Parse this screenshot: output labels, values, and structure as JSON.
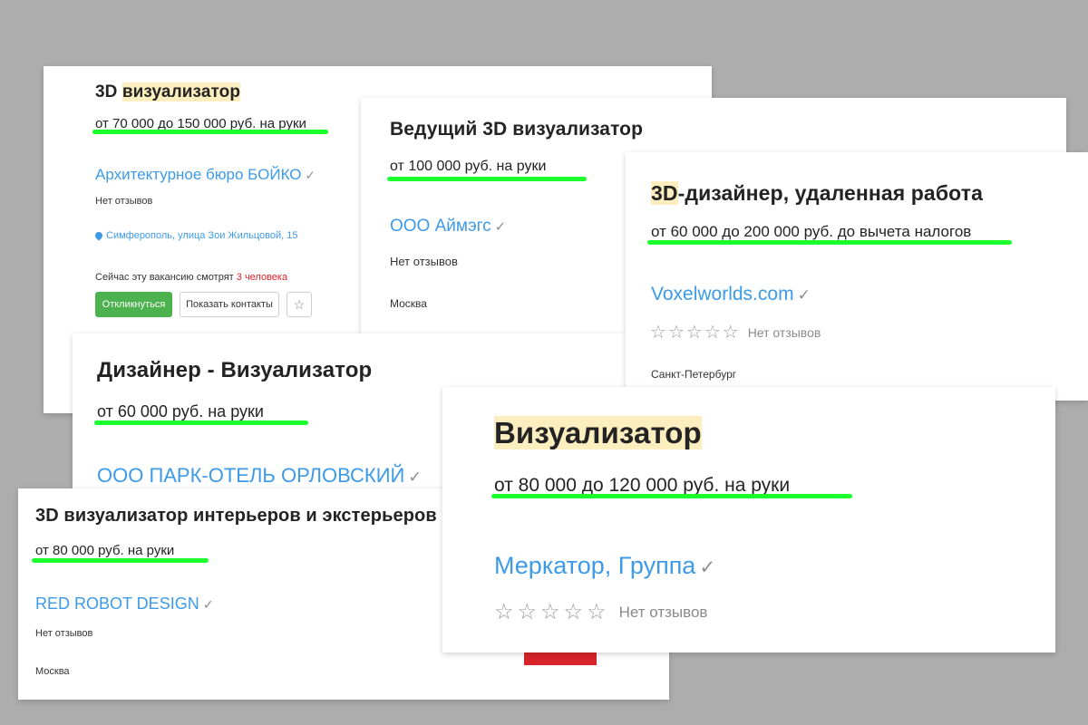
{
  "card1": {
    "title_highlight_prefix": "3D ",
    "title_highlight": "визуализатор",
    "salary": "от 70 000 до 150 000 руб. на руки",
    "company": "Архитектурное бюро БОЙКО",
    "reviews": "Нет отзывов",
    "address": "Симферополь, улица Зои Жильцовой, 15",
    "watching_prefix": "Сейчас эту вакансию смотрят ",
    "watching_count": "3 человека",
    "respond_button": "Откликнуться",
    "contacts_button": "Показать контакты"
  },
  "card2": {
    "title": "Ведущий 3D визуализатор",
    "salary": "от 100 000 руб. на руки",
    "company": "ООО Аймэгс",
    "reviews": "Нет отзывов",
    "city": "Москва"
  },
  "card3": {
    "title_highlight": "3D",
    "title_rest": "-дизайнер, удаленная работа",
    "salary": "от 60 000 до 200 000 руб. до вычета налогов",
    "company": "Voxelworlds.com",
    "reviews": "Нет отзывов",
    "city": "Санкт-Петербург"
  },
  "card4": {
    "title": "Дизайнер - Визуализатор",
    "salary": "от 60 000 руб. на руки",
    "company": "ООО ПАРК-ОТЕЛЬ ОРЛОВСКИЙ"
  },
  "card5": {
    "title": "3D визуализатор интерьеров и экстерьеров",
    "salary": "от 80 000 руб. на руки",
    "company": "RED ROBOT DESIGN",
    "reviews": "Нет отзывов",
    "city": "Москва"
  },
  "card6": {
    "title": "Визуализатор",
    "salary": "от 80 000 до 120 000 руб. на руки",
    "company": "Меркатор, Группа",
    "reviews": "Нет отзывов"
  },
  "icons": {
    "verified": "check-icon",
    "favorite": "star-icon",
    "rating": "star-outline-icon",
    "location": "map-pin-icon"
  },
  "colors": {
    "background": "#adadad",
    "link": "#3d9ae8",
    "highlight": "#fdeebf",
    "underline": "#1aff2e",
    "respond_button": "#4bb24e",
    "watching_count": "#e0242a",
    "red_block": "#d8232a"
  }
}
